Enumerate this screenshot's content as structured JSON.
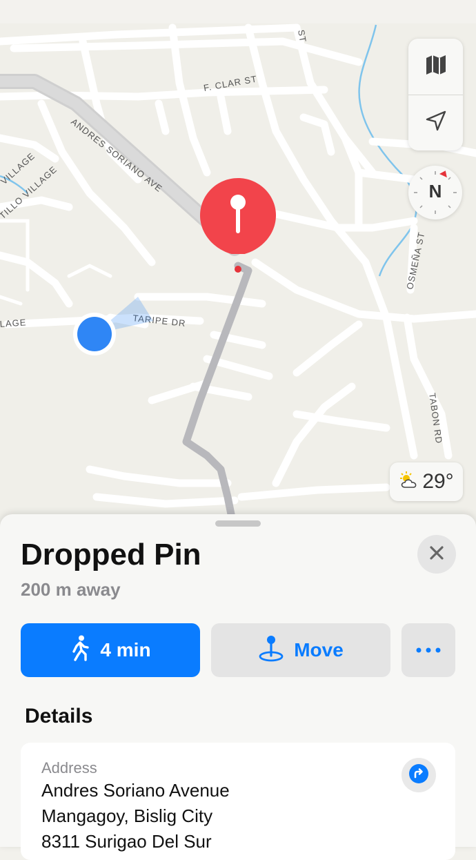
{
  "map": {
    "street_labels": {
      "andres": "ANDRES SORIANO AVE",
      "fclar": "F. CLAR ST",
      "taripe": "TARIPE DR",
      "osmena": "OSMEÑA ST",
      "tabon": "TABON RD",
      "tillo": "TILLO VILLAGE",
      "village_left": "VILLAGE",
      "lage": "LAGE",
      "st_top": "ST"
    },
    "compass_label": "N",
    "weather": {
      "temp": "29°",
      "icon": "partly-sunny-icon"
    },
    "accent_colors": {
      "pin": "#f2444b",
      "user": "#2f86f5",
      "route": "#b8b8bc"
    }
  },
  "controls": {
    "map_icon": "map-icon",
    "location_icon": "location-arrow-icon"
  },
  "sheet": {
    "title": "Dropped Pin",
    "distance": "200 m away",
    "walk_label": "4 min",
    "move_label": "Move",
    "details_heading": "Details",
    "address": {
      "label": "Address",
      "line1": "Andres Soriano Avenue",
      "line2": "Mangagoy, Bislig City",
      "line3": "8311 Surigao Del Sur"
    }
  }
}
